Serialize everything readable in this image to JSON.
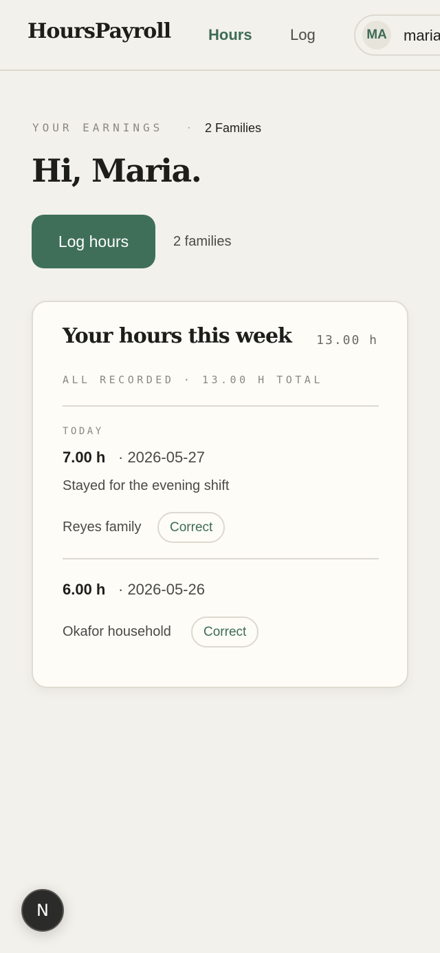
{
  "header": {
    "brand": "HoursPayroll",
    "nav": [
      {
        "label": "Hours",
        "active": true
      },
      {
        "label": "Log",
        "active": false
      }
    ],
    "user": {
      "initials": "MA",
      "name": "maria"
    }
  },
  "intro": {
    "eyebrow": "YOUR EARNINGS",
    "separator": "·",
    "families_badge": "2 Families",
    "greeting": "Hi, Maria.",
    "log_button": "Log hours",
    "families_note": "2 families"
  },
  "card": {
    "title": "Your hours this week",
    "total": "13.00 h",
    "subtitle": "ALL RECORDED · 13.00 H TOTAL",
    "entries": [
      {
        "label": "TODAY",
        "hours": "7.00 h",
        "date": "· 2026-05-27",
        "note": "Stayed for the evening shift",
        "family": "Reyes family",
        "action": "Correct"
      },
      {
        "label": "",
        "hours": "6.00 h",
        "date": "· 2026-05-26",
        "note": "",
        "family": "Okafor household",
        "action": "Correct"
      }
    ]
  },
  "fab": {
    "label": "N"
  },
  "colors": {
    "accent": "#3f6f59",
    "background": "#f3f1eb",
    "card": "#fdfcf7"
  }
}
